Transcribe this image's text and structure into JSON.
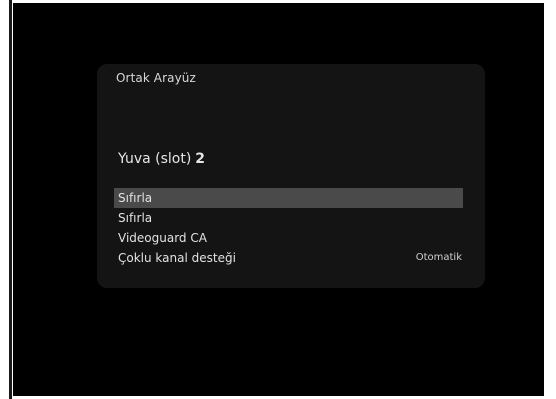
{
  "panel": {
    "title": "Ortak Arayüz",
    "slot_label": "Yuva (slot)",
    "slot_number": "2"
  },
  "menu": {
    "items": [
      {
        "label": "Sıfırla",
        "value": "",
        "selected": true
      },
      {
        "label": "Sıfırla",
        "value": "",
        "selected": false
      },
      {
        "label": "Videoguard CA",
        "value": "",
        "selected": false
      },
      {
        "label": "Çoklu kanal desteği",
        "value": "Otomatik",
        "selected": false
      }
    ]
  },
  "colors": {
    "background": "#000000",
    "panel": "#141414",
    "highlight": "#4a4a4a",
    "text": "#e2e2e2"
  }
}
